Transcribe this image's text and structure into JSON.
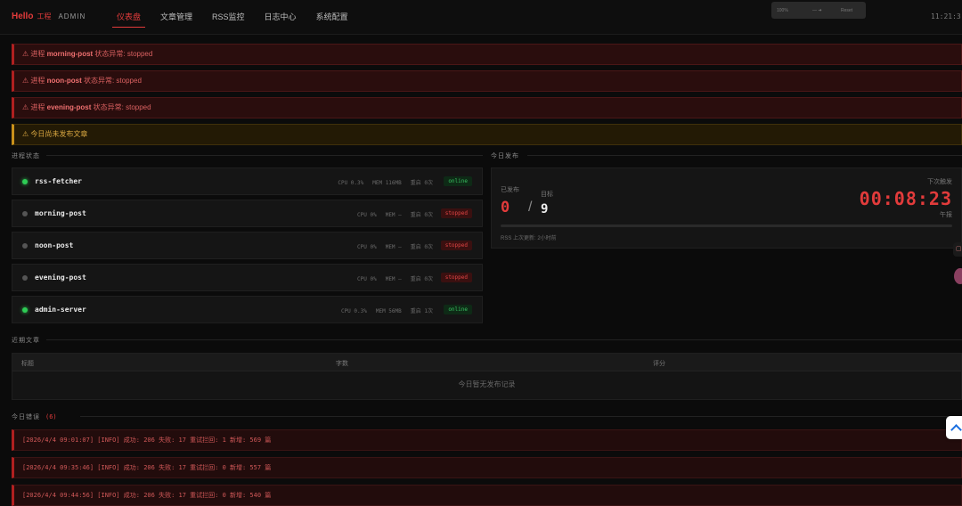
{
  "brand": {
    "logo": "Hello",
    "cn": "工程",
    "admin": "ADMIN"
  },
  "nav": [
    {
      "label": "仪表盘",
      "active": true
    },
    {
      "label": "文章管理"
    },
    {
      "label": "RSS监控"
    },
    {
      "label": "日志中心"
    },
    {
      "label": "系统配置"
    }
  ],
  "overlay": {
    "left": "100%",
    "mid": "— ➜",
    "right": "Reset"
  },
  "clock": "11:21:3",
  "alerts": [
    {
      "prefix": "⚠ 进程",
      "name": "morning-post",
      "suffix": "状态异常: stopped"
    },
    {
      "prefix": "⚠ 进程",
      "name": "noon-post",
      "suffix": "状态异常: stopped"
    },
    {
      "prefix": "⚠ 进程",
      "name": "evening-post",
      "suffix": "状态异常: stopped"
    }
  ],
  "warning": "⚠ 今日尚未发布文章",
  "sections": {
    "process_status": "进程状态",
    "today_publish": "今日发布",
    "recent_articles": "近期文章",
    "today_errors": "今日错误",
    "error_count": "(6)"
  },
  "processes": [
    {
      "name": "rss-fetcher",
      "status": "online",
      "cpu": "CPU 0.3%",
      "mem": "MEM 116MB",
      "restarts": "重启 0次"
    },
    {
      "name": "morning-post",
      "status": "stopped",
      "cpu": "CPU 0%",
      "mem": "MEM —",
      "restarts": "重启 0次"
    },
    {
      "name": "noon-post",
      "status": "stopped",
      "cpu": "CPU 0%",
      "mem": "MEM —",
      "restarts": "重启 0次"
    },
    {
      "name": "evening-post",
      "status": "stopped",
      "cpu": "CPU 0%",
      "mem": "MEM —",
      "restarts": "重启 0次"
    },
    {
      "name": "admin-server",
      "status": "online",
      "cpu": "CPU 0.3%",
      "mem": "MEM 56MB",
      "restarts": "重启 1次"
    }
  ],
  "publish": {
    "published_label": "已发布",
    "published": "0",
    "target_label": "目标",
    "target": "9",
    "next_label": "下次触发",
    "countdown": "00:08:23",
    "slot": "午报",
    "rss_update": "RSS 上次更新: 2小时前"
  },
  "articles_table": {
    "columns": [
      "标题",
      "字数",
      "评分"
    ],
    "empty": "今日暂无发布记录"
  },
  "error_logs": [
    "[2026/4/4 09:01:07] [INFO] 成功: 206 失败: 17 重试拦回: 1 新增: 569 篇",
    "[2026/4/4 09:35:46] [INFO] 成功: 206 失败: 17 重试拦回: 0 新增: 557 篇",
    "[2026/4/4 09:44:56] [INFO] 成功: 206 失败: 17 重试拦回: 0 新增: 540 篇"
  ]
}
